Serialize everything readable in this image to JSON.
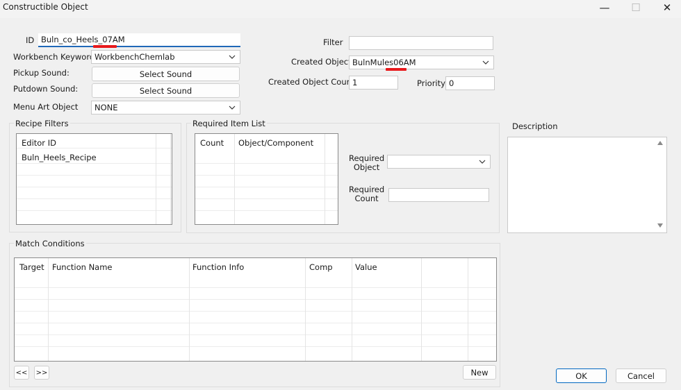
{
  "window": {
    "title": "Constructible Object",
    "minimize": "—",
    "maximize": "☐",
    "close": "✕"
  },
  "form": {
    "id_label": "ID",
    "id_value": "Buln_co_Heels_07AM",
    "workbench_label": "Workbench Keyword",
    "workbench_value": "WorkbenchChemlab",
    "pickup_label": "Pickup Sound:",
    "pickup_button": "Select Sound",
    "putdown_label": "Putdown Sound:",
    "putdown_button": "Select Sound",
    "menuart_label": "Menu Art Object",
    "menuart_value": "NONE",
    "filter_label": "Filter",
    "filter_value": "",
    "created_label": "Created Object",
    "created_value": "BulnMules06AM",
    "count_label": "Created Object Count",
    "count_value": "1",
    "priority_label": "Priority",
    "priority_value": "0"
  },
  "recipe_filters": {
    "title": "Recipe Filters",
    "header": "Editor ID",
    "rows": [
      "Buln_Heels_Recipe"
    ]
  },
  "required_items": {
    "title": "Required Item List",
    "columns": [
      "Count",
      "Object/Component"
    ],
    "required_object_label": "Required\nObject",
    "required_object_value": "",
    "required_count_label": "Required\nCount",
    "required_count_value": ""
  },
  "description": {
    "label": "Description",
    "value": ""
  },
  "match_conditions": {
    "title": "Match Conditions",
    "columns": [
      "Target",
      "Function Name",
      "Function Info",
      "Comp",
      "Value"
    ],
    "prev_button": "<<",
    "next_button": ">>",
    "new_button": "New"
  },
  "footer": {
    "ok": "OK",
    "cancel": "Cancel"
  },
  "colors": {
    "highlight_mark": "#e8191c",
    "focus_underline": "#1f68b8",
    "default_button_border": "#0067c0"
  },
  "icons": {
    "dropdown": "chevron-down-icon",
    "scroll_up": "scroll-up-arrow-icon",
    "scroll_down": "scroll-down-arrow-icon"
  }
}
